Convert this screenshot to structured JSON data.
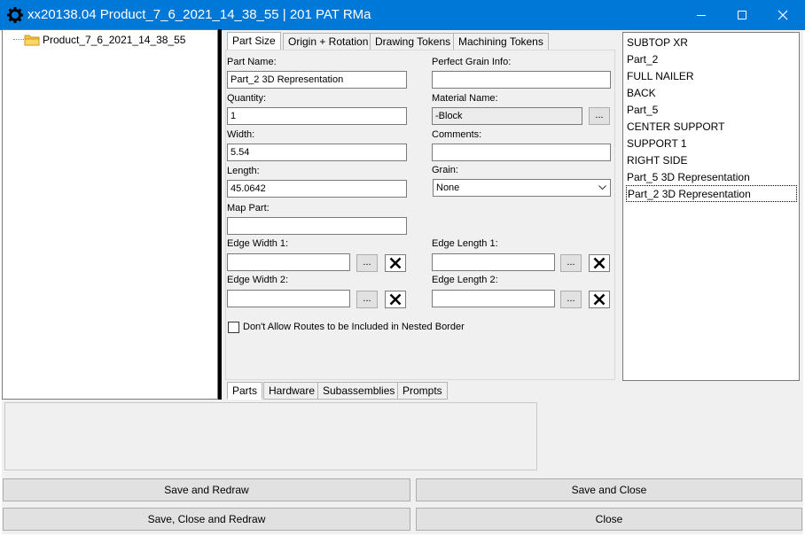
{
  "window": {
    "title": "xx20138.04 Product_7_6_2021_14_38_55 | 201 PAT RMa",
    "icon": "gear-icon",
    "titlebar_color": "#0078d7"
  },
  "tree": {
    "items": [
      {
        "label": "Product_7_6_2021_14_38_55",
        "icon": "folder-icon"
      }
    ]
  },
  "tabs": [
    {
      "label": "Part Size"
    },
    {
      "label": "Origin + Rotation"
    },
    {
      "label": "Drawing Tokens"
    },
    {
      "label": "Machining Tokens"
    }
  ],
  "part_size": {
    "part_name_label": "Part Name:",
    "part_name_value": "Part_2 3D Representation",
    "quantity_label": "Quantity:",
    "quantity_value": "1",
    "width_label": "Width:",
    "width_value": "5.54",
    "length_label": "Length:",
    "length_value": "45.0642",
    "map_part_label": "Map Part:",
    "map_part_value": "",
    "perfect_grain_label": "Perfect Grain Info:",
    "perfect_grain_value": "",
    "material_name_label": "Material Name:",
    "material_name_value": "-Block",
    "comments_label": "Comments:",
    "comments_value": "",
    "grain_label": "Grain:",
    "grain_value": "None",
    "edge_width1_label": "Edge Width 1:",
    "edge_width2_label": "Edge  Width 2:",
    "edge_length1_label": "Edge Length 1:",
    "edge_length2_label": "Edge Length 2:",
    "browse_label": "...",
    "nested_border_label": "Don't Allow Routes to be Included in Nested Border"
  },
  "parts_list": [
    {
      "label": "SUBTOP XR"
    },
    {
      "label": "Part_2"
    },
    {
      "label": "FULL NAILER"
    },
    {
      "label": "BACK"
    },
    {
      "label": "Part_5"
    },
    {
      "label": "CENTER SUPPORT"
    },
    {
      "label": "SUPPORT 1"
    },
    {
      "label": "RIGHT SIDE"
    },
    {
      "label": "Part_5 3D Representation"
    },
    {
      "label": "Part_2 3D Representation"
    }
  ],
  "bottom_tabs": [
    {
      "label": "Parts"
    },
    {
      "label": "Hardware"
    },
    {
      "label": "Subassemblies"
    },
    {
      "label": "Prompts"
    }
  ],
  "buttons": {
    "save_redraw": "Save and Redraw",
    "save_close": "Save and Close",
    "save_close_redraw": "Save, Close and Redraw",
    "close": "Close"
  }
}
